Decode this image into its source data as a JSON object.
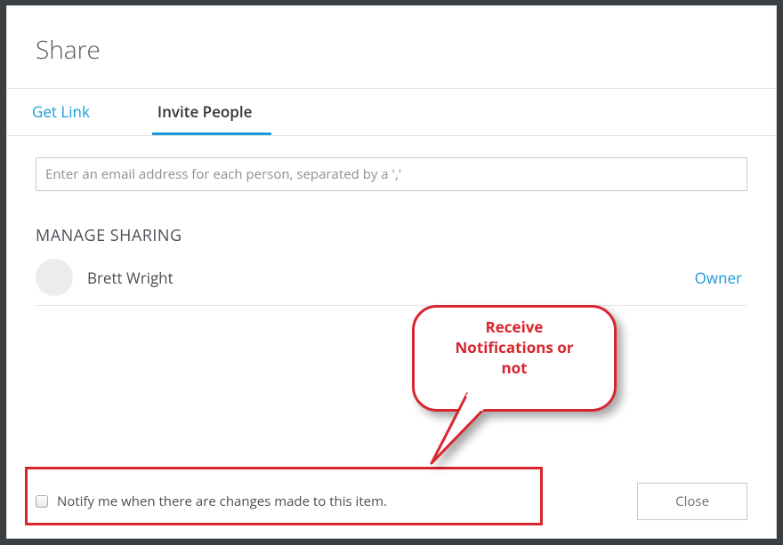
{
  "header": {
    "title": "Share"
  },
  "tabs": {
    "get_link": "Get Link",
    "invite_people": "Invite People"
  },
  "invite": {
    "email_placeholder": "Enter an email address for each person, separated by a ','"
  },
  "sharing": {
    "heading": "MANAGE SHARING",
    "members": [
      {
        "name": "Brett Wright",
        "role": "Owner"
      }
    ]
  },
  "footer": {
    "notify_label": "Notify me when there are changes made to this item.",
    "close_label": "Close"
  },
  "annotation": {
    "callout_text": "Receive\nNotifications or\nnot"
  }
}
